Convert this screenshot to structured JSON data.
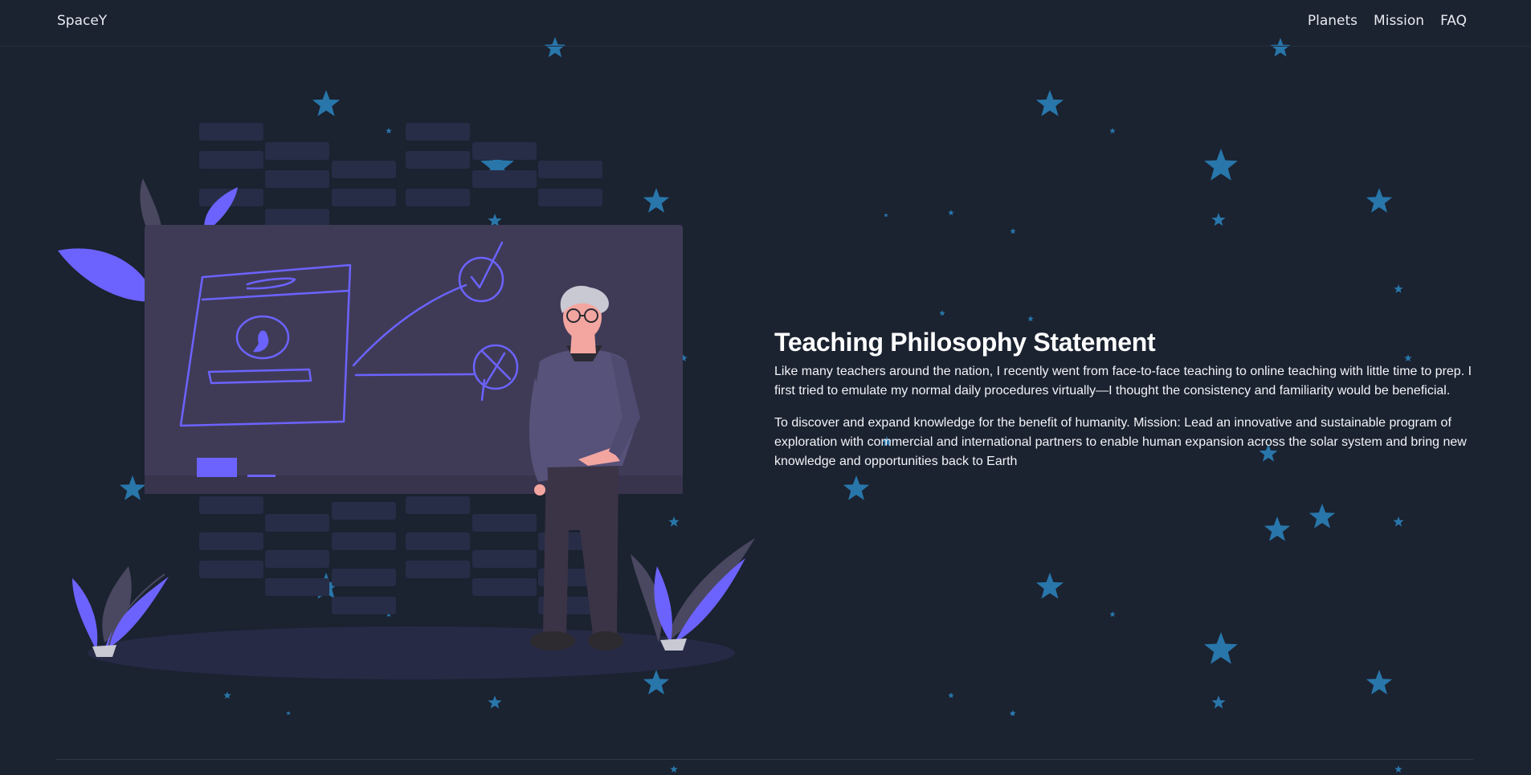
{
  "brand": "SpaceY",
  "nav": {
    "links": [
      "Planets",
      "Mission",
      "FAQ"
    ]
  },
  "hero": {
    "title": "Teaching Philosophy Statement",
    "paragraphs": [
      "Like many teachers around the nation, I recently went from face-to-face teaching to online teaching with little time to prep. I first tried to emulate my normal daily procedures virtually—I thought the consistency and familiarity would be beneficial.",
      "To discover and expand knowledge for the benefit of humanity. Mission: Lead an innovative and sustainable program of exploration with commercial and international partners to enable human expansion across the solar system and bring new knowledge and opportunities back to Earth"
    ]
  },
  "colors": {
    "background": "#1b2230",
    "star": "#2a80b8",
    "accent": "#6c63ff"
  },
  "icons": [
    "star-icon",
    "teacher-illustration"
  ]
}
